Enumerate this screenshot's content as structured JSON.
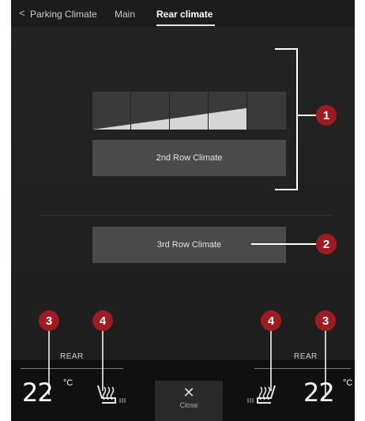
{
  "nav": {
    "back_glyph": "<",
    "tabs": [
      {
        "label": "Parking Climate"
      },
      {
        "label": "Main"
      },
      {
        "label": "Rear climate",
        "active": true
      }
    ]
  },
  "fan": {
    "level": 4,
    "max_level": 5
  },
  "buttons": {
    "second_row": "2nd Row Climate",
    "third_row": "3rd Row Climate"
  },
  "bottom": {
    "left": {
      "label": "REAR",
      "temp": "22",
      "unit": "°C"
    },
    "right": {
      "label": "REAR",
      "temp": "22",
      "unit": "°C"
    },
    "close_glyph": "✕",
    "close_label": "Close"
  },
  "callouts": [
    "1",
    "2",
    "3",
    "4",
    "4",
    "3"
  ],
  "colors": {
    "callout": "#9e1b22",
    "button": "#4a4a4a",
    "background": "#151515"
  }
}
